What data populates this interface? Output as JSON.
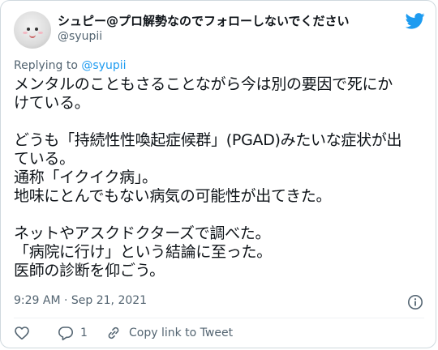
{
  "tweet": {
    "display_name": "シュピー@プロ解勢なのでフォローしないでください",
    "handle": "@syupii",
    "reply_prefix": "Replying to ",
    "reply_mention": "@syupii",
    "body": "メンタルのこともさることながら今は別の要因で死にか\nけている。\n\nどうも「持続性性喚起症候群」(PGAD)みたいな症状が出\nている。\n通称「イクイク病」。\n地味にとんでもない病気の可能性が出てきた。\n\nネットやアスクドクターズで調べた。\n「病院に行け」という結論に至った。\n医師の診断を仰ごう。",
    "timestamp": "9:29 AM · Sep 21, 2021",
    "reply_count": "1",
    "copy_link_label": "Copy link to Tweet"
  },
  "icons": {
    "logo": "twitter-bird-icon",
    "info": "info-icon",
    "like": "heart-icon",
    "reply": "reply-bubble-icon",
    "copy": "link-icon"
  },
  "colors": {
    "accent": "#1d9bf0",
    "text": "#0f1419",
    "secondary": "#536471",
    "border": "#cfd9de"
  }
}
